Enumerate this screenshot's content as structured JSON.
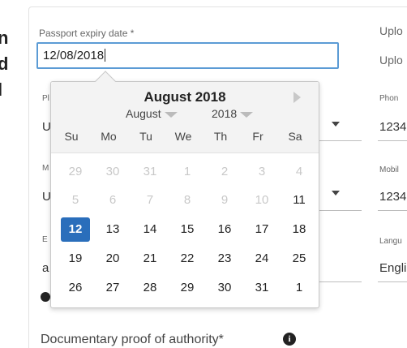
{
  "left_text": [
    "n",
    "d",
    "l"
  ],
  "passport": {
    "label": "Passport expiry date *",
    "value": "12/08/2018"
  },
  "left_fields": [
    {
      "label": "Pl",
      "value": "U"
    },
    {
      "label": "M",
      "value": "U"
    },
    {
      "label": "E",
      "value": "a"
    }
  ],
  "right_column": {
    "upload1": "Uplo",
    "upload2": "Uplo",
    "phone_label": "Phon",
    "phone_value": "1234",
    "mobile_label": "Mobil",
    "mobile_value": "1234",
    "language_label": "Langu",
    "language_value": "Engli"
  },
  "calendar": {
    "title": "August 2018",
    "month_select": "August",
    "year_select": "2018",
    "weekdays": [
      "Su",
      "Mo",
      "Tu",
      "We",
      "Th",
      "Fr",
      "Sa"
    ],
    "weeks": [
      [
        "29",
        "30",
        "31",
        "1",
        "2",
        "3",
        "4"
      ],
      [
        "5",
        "6",
        "7",
        "8",
        "9",
        "10",
        "11"
      ],
      [
        "12",
        "13",
        "14",
        "15",
        "16",
        "17",
        "18"
      ],
      [
        "19",
        "20",
        "21",
        "22",
        "23",
        "24",
        "25"
      ],
      [
        "26",
        "27",
        "28",
        "29",
        "30",
        "31",
        "1"
      ]
    ],
    "selected_day": "12"
  },
  "footer": {
    "label": "Documentary proof of authority*",
    "info_icon": "info-icon"
  },
  "colors": {
    "selected": "#2a6ebb",
    "focus_border": "#5b9bd5"
  }
}
